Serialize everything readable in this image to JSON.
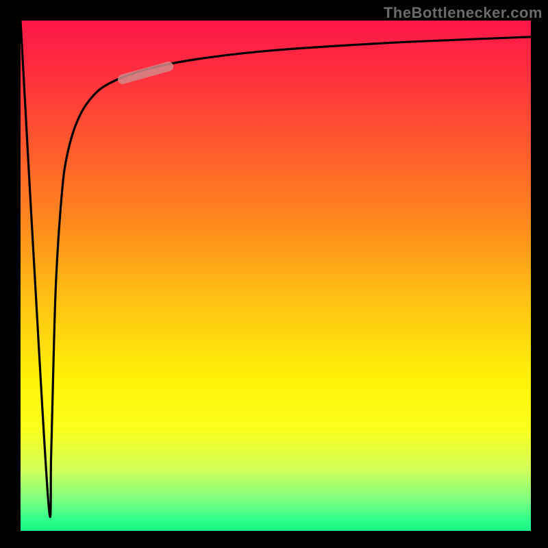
{
  "watermark": "TheBottlenecker.com",
  "chart_data": {
    "type": "line",
    "title": "",
    "xlabel": "",
    "ylabel": "",
    "xlim": [
      0,
      100
    ],
    "ylim": [
      0,
      100
    ],
    "grid": false,
    "legend": false,
    "background_gradient_top": "#fd1748",
    "background_gradient_bottom": "#19f582",
    "series": [
      {
        "name": "main-curve",
        "color": "#000000",
        "x": [
          0.0,
          2.5,
          5.5,
          6.0,
          6.5,
          7.0,
          8.0,
          9.0,
          11.0,
          14.0,
          18.0,
          25.0,
          35.0,
          50.0,
          70.0,
          85.0,
          100.0
        ],
        "y": [
          100,
          55,
          5,
          15,
          35,
          50,
          65,
          73,
          80,
          85,
          88,
          90.5,
          92.5,
          94.2,
          95.5,
          96.2,
          96.8
        ]
      },
      {
        "name": "highlight-segment",
        "color": "#d48a8a",
        "x": [
          20,
          29
        ],
        "y": [
          88.5,
          91
        ]
      }
    ]
  }
}
